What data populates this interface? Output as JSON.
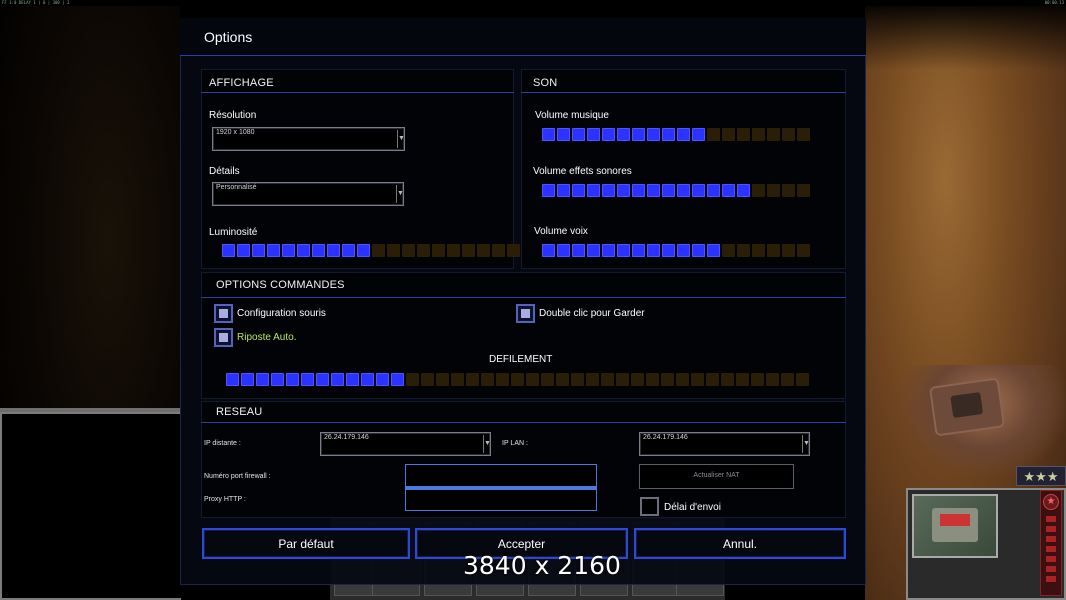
{
  "topbar": {
    "left_text": "FF 1:0 DELAY 1 | 0 | 300 | 2",
    "right_text": "00:00:13"
  },
  "dialog": {
    "title": "Options"
  },
  "affichage": {
    "header": "AFFICHAGE",
    "resolution": {
      "label": "Résolution",
      "value": "1920 x 1080"
    },
    "details": {
      "label": "Détails",
      "value": "Personnalisé"
    },
    "luminosite": {
      "label": "Luminosité",
      "level": 0.5,
      "segments": 20
    }
  },
  "son": {
    "header": "SON",
    "musique": {
      "label": "Volume musique",
      "level": 0.6,
      "segments": 18
    },
    "effets": {
      "label": "Volume effets sonores",
      "level": 0.8,
      "segments": 18
    },
    "voix": {
      "label": "Volume voix",
      "level": 0.67,
      "segments": 18
    }
  },
  "commandes": {
    "header": "OPTIONS COMMANDES",
    "config_souris": {
      "label": "Configuration souris",
      "checked": true
    },
    "riposte_auto": {
      "label": "Riposte Auto.",
      "checked": true
    },
    "double_clic": {
      "label": "Double clic pour Garder",
      "checked": true
    },
    "defilement": {
      "label": "DEFILEMENT",
      "level": 0.3,
      "segments": 39
    }
  },
  "reseau": {
    "header": "RESEAU",
    "ip_distante": {
      "label": "IP distante :",
      "value": "26.24.179.146"
    },
    "ip_lan": {
      "label": "IP LAN :",
      "value": "26.24.179.146"
    },
    "port_firewall": {
      "label": "Numéro port firewall :",
      "value": ""
    },
    "proxy_http": {
      "label": "Proxy HTTP :",
      "value": ""
    },
    "actualiser_nat": {
      "label": "Actualiser NAT"
    },
    "delai_envoi": {
      "label": "Délai d'envoi",
      "checked": false
    }
  },
  "buttons": {
    "defaut": "Par défaut",
    "accepter": "Accepter",
    "annuler": "Annul."
  },
  "overlay": {
    "resolution_text": "3840 x 2160"
  },
  "hud": {
    "rank_stars": "★★★",
    "side_star": "★"
  },
  "colors": {
    "accent": "#2c49d8",
    "slider_on": "#2a33ff",
    "slider_off": "#2a1e06",
    "green_text": "#b6e65a"
  }
}
